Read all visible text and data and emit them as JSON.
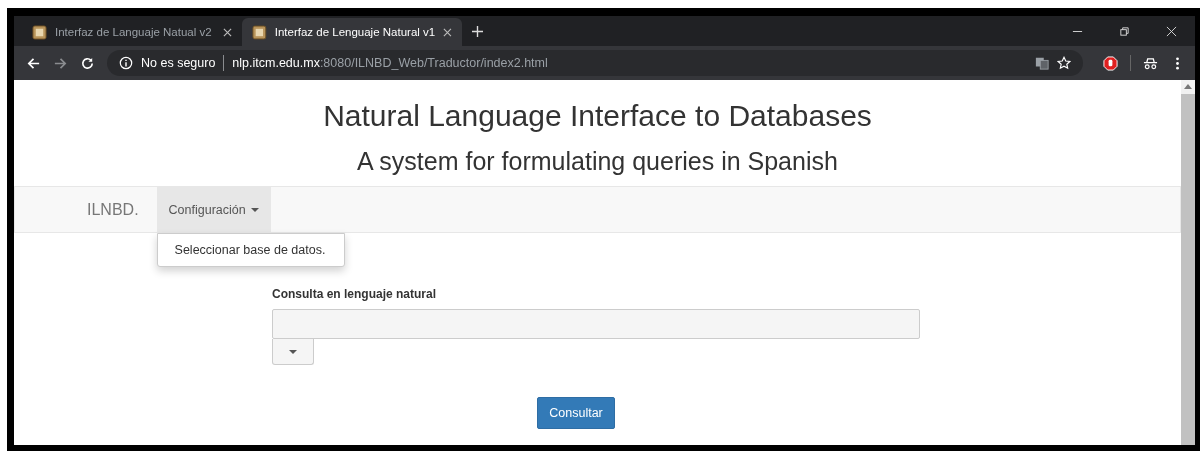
{
  "browser": {
    "tabs": [
      {
        "title": "Interfaz de Languaje Natual v2",
        "selected": false
      },
      {
        "title": "Interfaz de Lenguaje Natural v1",
        "selected": true
      }
    ],
    "security": "No es seguro",
    "url_host": "nlp.itcm.edu.mx",
    "url_path": ":8080/ILNBD_Web/Traductor/index2.html"
  },
  "page": {
    "title": "Natural Language Interface to Databases",
    "subtitle": "A system for formulating queries in Spanish",
    "navbar": {
      "brand": "ILNBD.",
      "menu": {
        "label": "Configuración",
        "expanded": true,
        "items": [
          "Seleccionar base de datos."
        ]
      }
    },
    "form": {
      "label": "Consulta en lenguaje natural",
      "submit": "Consultar"
    }
  }
}
